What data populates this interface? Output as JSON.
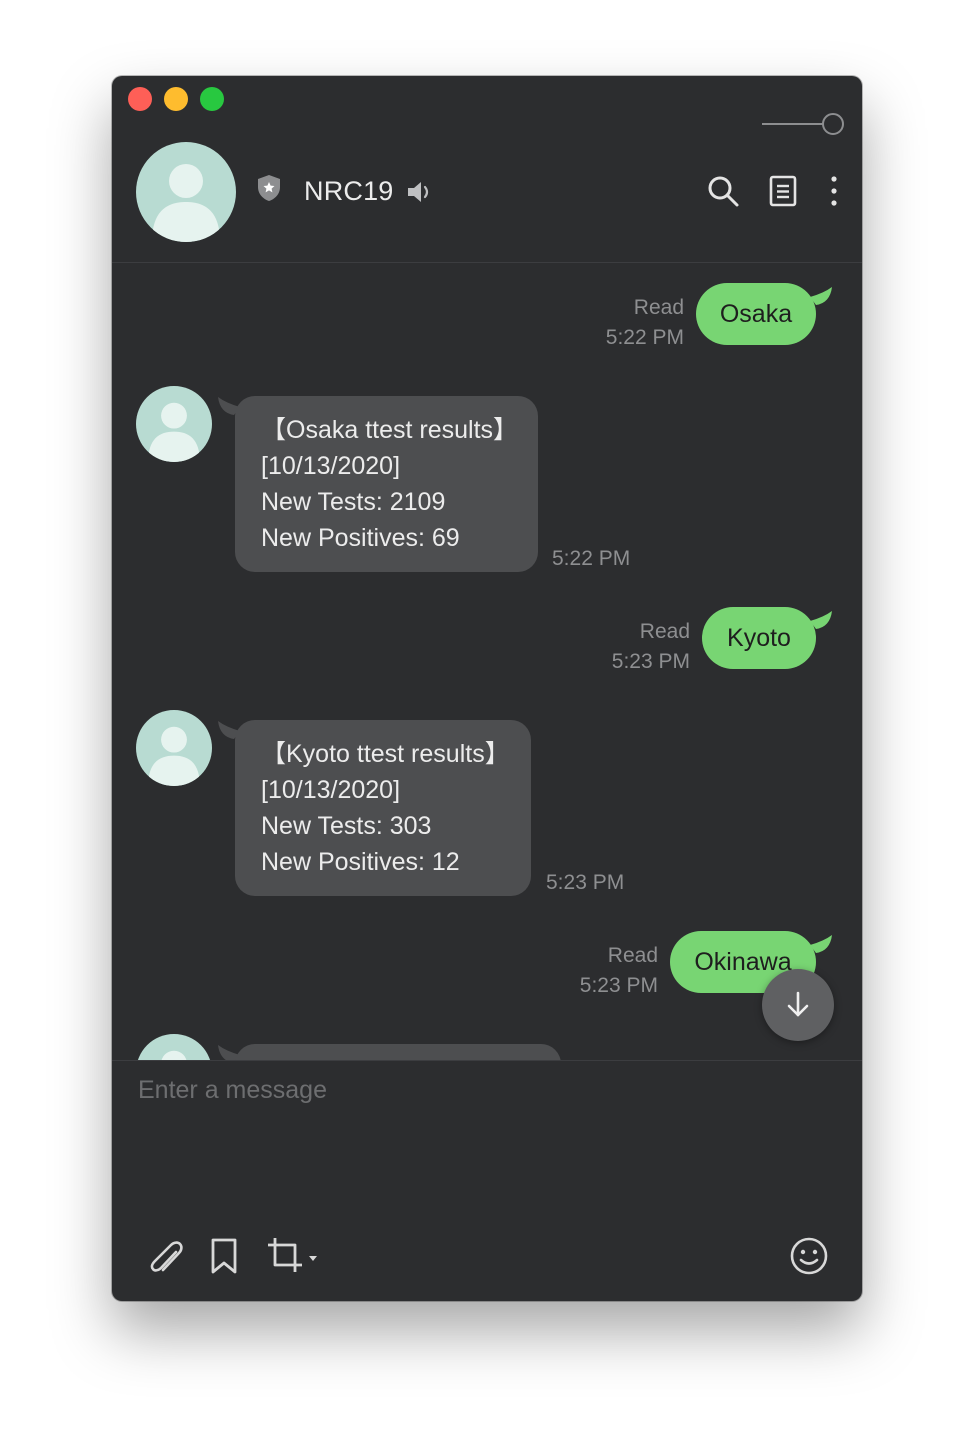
{
  "chat": {
    "title": "NRC19"
  },
  "messages": [
    {
      "direction": "outgoing",
      "text": "Osaka",
      "status": "Read",
      "time": "5:22 PM"
    },
    {
      "direction": "incoming",
      "lines": [
        "【Osaka ttest results】",
        "[10/13/2020]",
        "New Tests: 2109",
        "New Positives: 69"
      ],
      "time": "5:22 PM"
    },
    {
      "direction": "outgoing",
      "text": "Kyoto",
      "status": "Read",
      "time": "5:23 PM"
    },
    {
      "direction": "incoming",
      "lines": [
        "【Kyoto ttest results】",
        "[10/13/2020]",
        "New Tests: 303",
        "New Positives: 12"
      ],
      "time": "5:23 PM"
    },
    {
      "direction": "outgoing",
      "text": "Okinawa",
      "status": "Read",
      "time": "5:23 PM"
    }
  ],
  "composer": {
    "placeholder": "Enter a message"
  },
  "icons": {
    "header": [
      "shield-icon",
      "speaker-icon",
      "search-icon",
      "notes-icon",
      "more-icon"
    ],
    "toolbar": [
      "paperclip-icon",
      "bookmark-icon",
      "crop-icon",
      "emoji-icon"
    ],
    "scroll": "arrow-down-icon"
  },
  "colors": {
    "window_bg": "#2c2d2f",
    "outgoing_bubble": "#78d573",
    "incoming_bubble": "#4d4e50",
    "avatar": "#b8dbd2",
    "meta_text": "#8e8f91"
  }
}
